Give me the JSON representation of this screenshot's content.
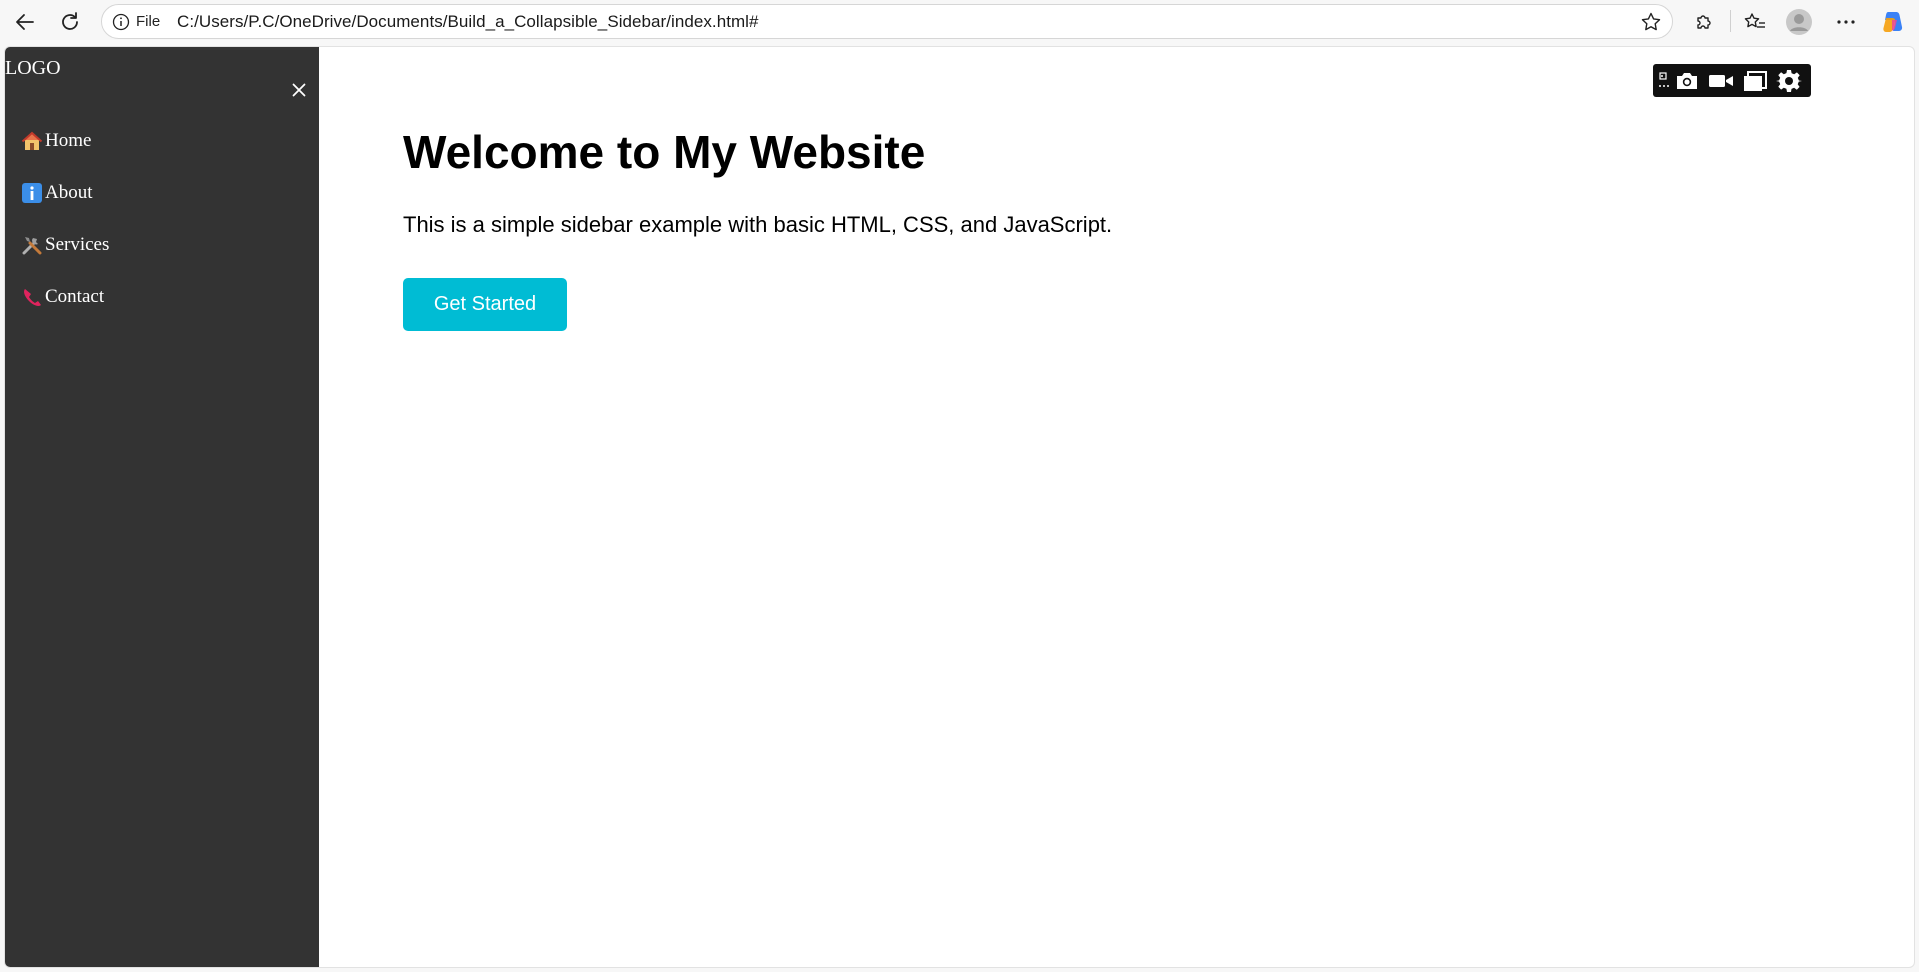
{
  "browser": {
    "address": {
      "protocol_label": "File",
      "url": "C:/Users/P.C/OneDrive/Documents/Build_a_Collapsible_Sidebar/index.html#"
    }
  },
  "sidebar": {
    "logo": "LOGO",
    "items": [
      {
        "icon": "house-icon",
        "label": "Home"
      },
      {
        "icon": "info-icon",
        "label": "About"
      },
      {
        "icon": "tools-icon",
        "label": "Services"
      },
      {
        "icon": "phone-icon",
        "label": "Contact"
      }
    ]
  },
  "main": {
    "title": "Welcome to My Website",
    "description": "This is a simple sidebar example with basic HTML, CSS, and JavaScript.",
    "cta_label": "Get Started"
  },
  "colors": {
    "sidebar_bg": "#333333",
    "accent": "#00bcd4",
    "capture_toolbar_bg": "#111111"
  }
}
